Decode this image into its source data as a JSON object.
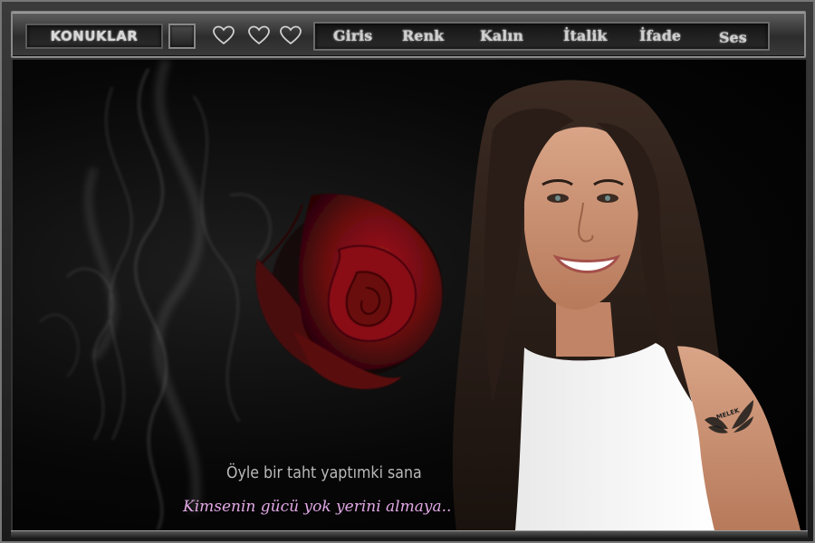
{
  "toolbar": {
    "title": "KONUKLAR",
    "hearts": [
      "heart-icon",
      "heart-icon",
      "heart-icon"
    ],
    "nav": [
      {
        "id": "giris",
        "label": "Giris"
      },
      {
        "id": "renk",
        "label": "Renk"
      },
      {
        "id": "kalin",
        "label": "Kalın"
      },
      {
        "id": "italik",
        "label": "İtalik"
      },
      {
        "id": "ifade",
        "label": "İfade"
      },
      {
        "id": "ses",
        "label": "Ses"
      }
    ]
  },
  "captions": {
    "line1": "Öyle bir taht yaptımki sana",
    "line2": "Kimsenin gücü yok yerini almaya.."
  },
  "watermark": {
    "text": "MELEK"
  },
  "colors": {
    "caption_primary": "#b9b9b9",
    "caption_secondary": "#e2a8e6",
    "rose": "#8a0f14",
    "background": "#000000"
  }
}
